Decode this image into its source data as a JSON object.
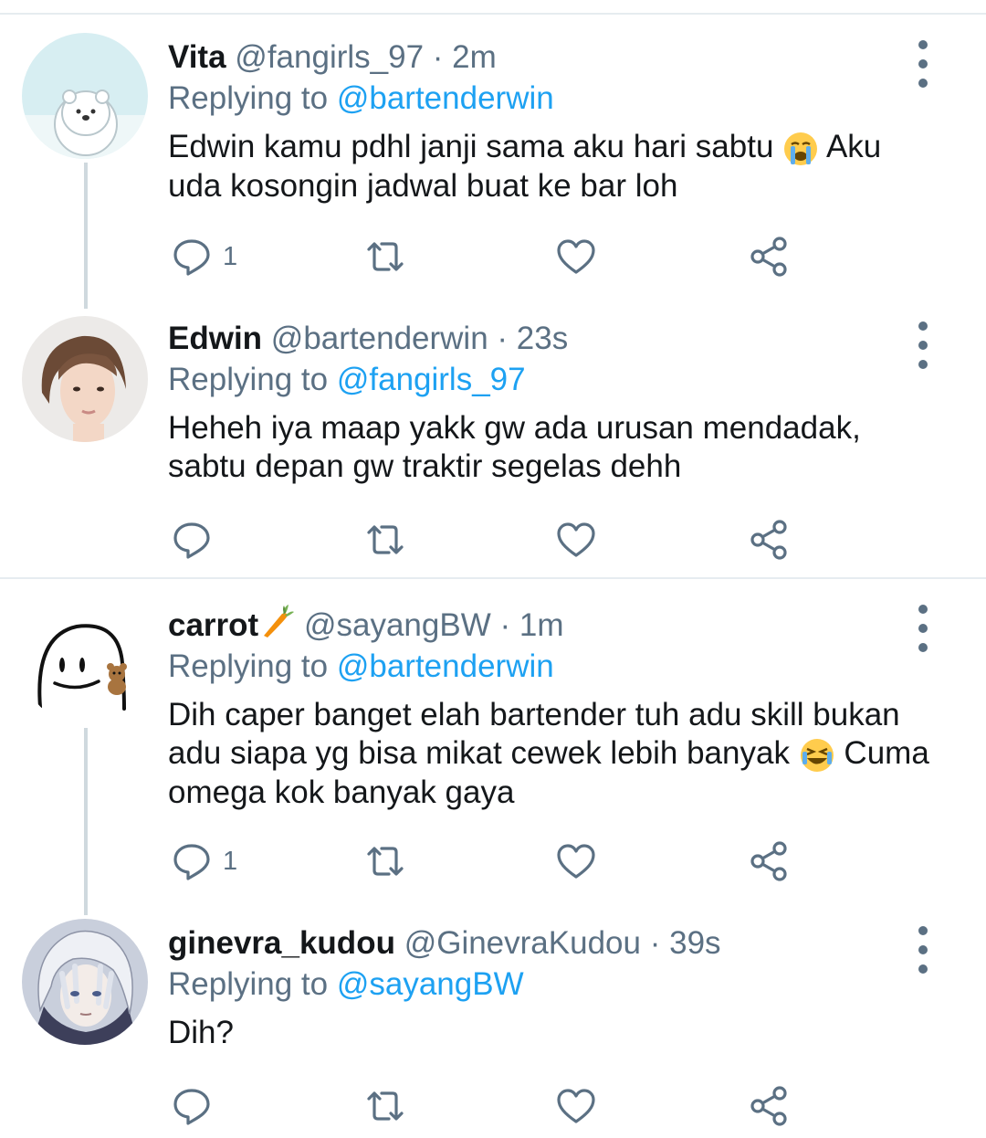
{
  "tweets": [
    {
      "name": "Vita",
      "handle": "@fangirls_97",
      "time": "· 2m",
      "replying_prefix": "Replying to",
      "replying_to": "@bartenderwin",
      "text_before_emoji": "Edwin kamu pdhl janji sama aku hari sabtu",
      "emoji": "loudly-crying-face",
      "text_after_emoji": "Aku uda kosongin jadwal buat ke bar loh",
      "reply_count": "1",
      "avatar": "polar-bear-avatar"
    },
    {
      "name": "Edwin",
      "handle": "@bartenderwin",
      "time": "· 23s",
      "replying_prefix": "Replying to",
      "replying_to": "@fangirls_97",
      "text": "Heheh iya maap yakk gw ada urusan mendadak, sabtu depan gw traktir segelas dehh",
      "reply_count": "",
      "avatar": "young-man-photo-avatar"
    },
    {
      "name": "carrot",
      "name_emoji": "carrot",
      "handle": "@sayangBW",
      "time": "· 1m",
      "replying_prefix": "Replying to",
      "replying_to": "@bartenderwin",
      "text_line1": "Dih caper banget elah bartender tuh adu skill bukan adu siapa yg bisa mikat cewek lebih banyak",
      "emoji": "grinning-squinting-face",
      "text_after_emoji": "Cuma omega kok banyak gaya",
      "reply_count": "1",
      "avatar": "doodle-blob-avatar"
    },
    {
      "name": "ginevra_kudou",
      "handle": "@GinevraKudou",
      "time": "· 39s",
      "replying_prefix": "Replying to",
      "replying_to": "@sayangBW",
      "text": "Dih?",
      "reply_count": "",
      "avatar": "anime-character-avatar"
    }
  ],
  "colors": {
    "text": "#14171a",
    "secondary": "#5b7083",
    "link": "#1da1f2",
    "divider": "#e6ecf0",
    "thread_line": "#cfd9de"
  }
}
